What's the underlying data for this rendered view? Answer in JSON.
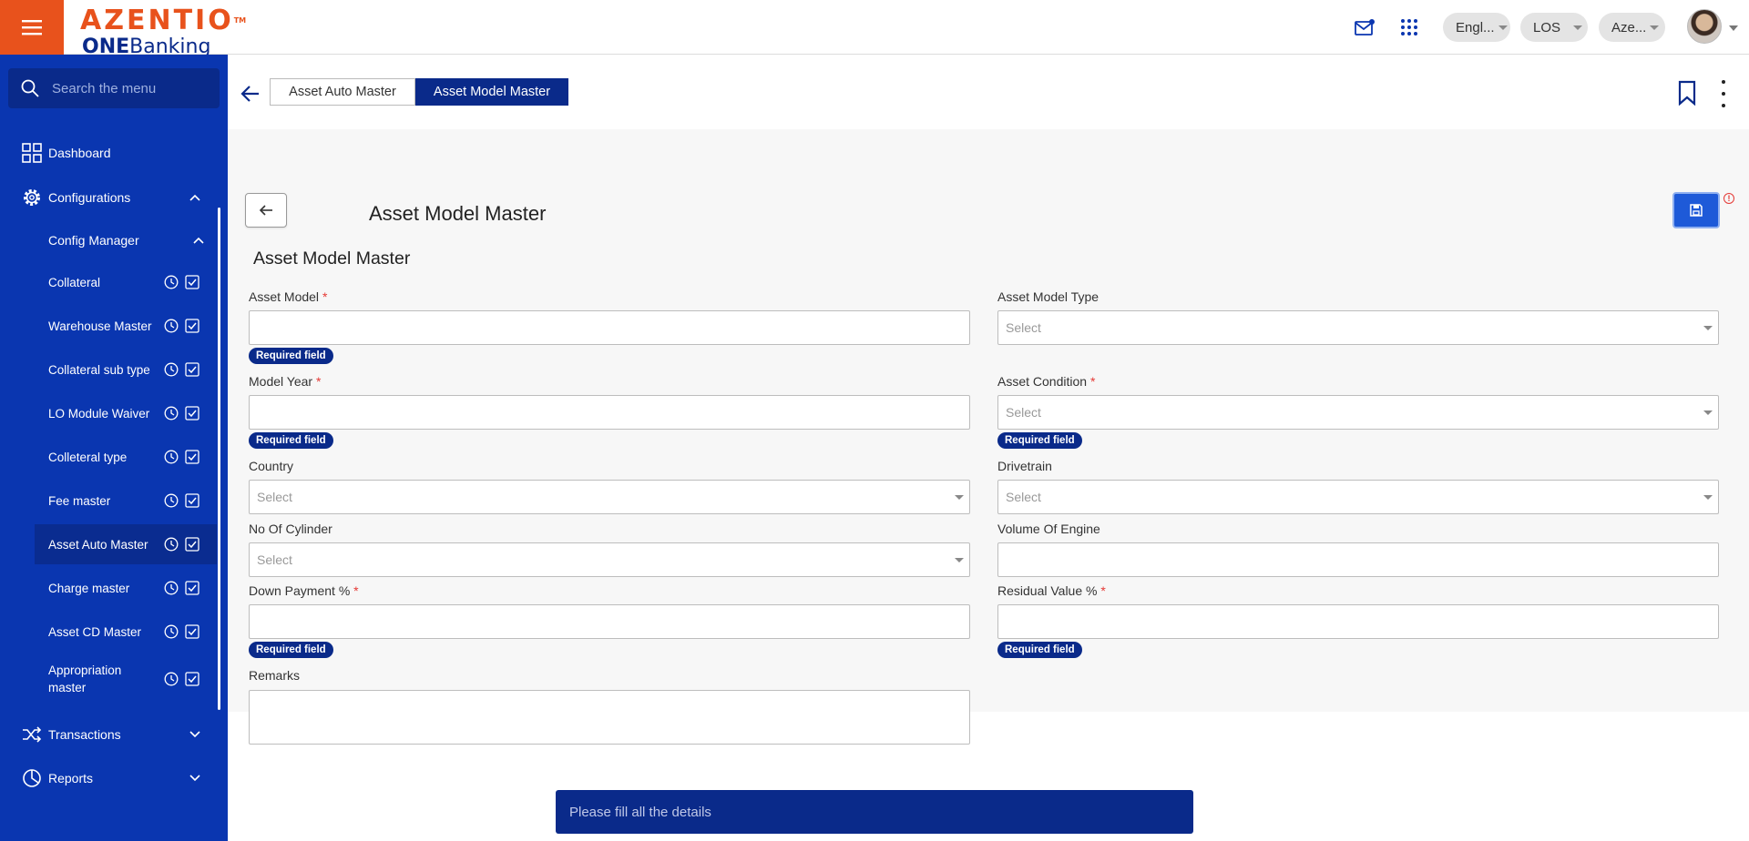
{
  "brand": {
    "logo": "AZENTIO",
    "trademark": "TM",
    "product_prefix": "ONE",
    "product_suffix": "Banking"
  },
  "topbar": {
    "language": "Engl...",
    "module": "LOS",
    "entity": "Aze..."
  },
  "sidebar": {
    "search_placeholder": "Search the menu",
    "dashboard": "Dashboard",
    "configurations": "Configurations",
    "config_manager": "Config Manager",
    "items": [
      {
        "label": "Collateral"
      },
      {
        "label": "Warehouse Master"
      },
      {
        "label": "Collateral sub type"
      },
      {
        "label": "LO Module Waiver"
      },
      {
        "label": "Colleteral type"
      },
      {
        "label": "Fee master"
      },
      {
        "label": "Asset Auto Master"
      },
      {
        "label": "Charge master"
      },
      {
        "label": "Asset CD Master"
      },
      {
        "label": "Appropriation master"
      }
    ],
    "transactions": "Transactions",
    "reports": "Reports"
  },
  "tabs": [
    {
      "label": "Asset Auto Master",
      "active": false
    },
    {
      "label": "Asset Model Master",
      "active": true
    }
  ],
  "page": {
    "title": "Asset Model Master",
    "section_title": "Asset Model Master",
    "info_mark": "!"
  },
  "form": {
    "asset_model": {
      "label": "Asset Model",
      "required_mark": "*",
      "value": "",
      "error": "Required field"
    },
    "asset_model_type": {
      "label": "Asset Model Type",
      "placeholder": "Select"
    },
    "model_year": {
      "label": "Model Year",
      "required_mark": "*",
      "value": "",
      "error": "Required field"
    },
    "asset_condition": {
      "label": "Asset Condition",
      "required_mark": "*",
      "placeholder": "Select",
      "error": "Required field"
    },
    "country": {
      "label": "Country",
      "placeholder": "Select"
    },
    "drivetrain": {
      "label": "Drivetrain",
      "placeholder": "Select"
    },
    "no_of_cylinder": {
      "label": "No Of Cylinder",
      "placeholder": "Select"
    },
    "volume_of_engine": {
      "label": "Volume Of Engine",
      "value": ""
    },
    "down_payment": {
      "label": "Down Payment %",
      "required_mark": "*",
      "value": "",
      "error": "Required field"
    },
    "residual_value": {
      "label": "Residual Value %",
      "required_mark": "*",
      "value": "",
      "error": "Required field"
    },
    "remarks": {
      "label": "Remarks",
      "value": ""
    }
  },
  "toast": {
    "message": "Please fill all the details"
  },
  "colors": {
    "brand_orange": "#e8521c",
    "sidebar_blue": "#0a36b0",
    "dark_blue": "#0a2a8a",
    "save_blue": "#1e5ad8",
    "required_red": "#e53935"
  }
}
